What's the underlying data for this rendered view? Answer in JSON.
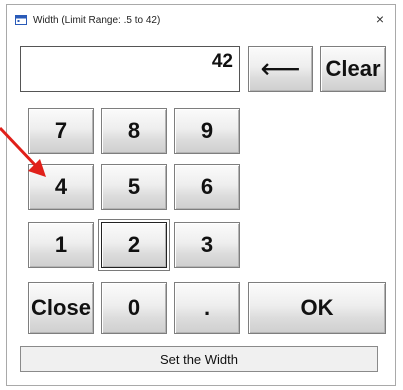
{
  "window": {
    "title_icon": "calculator-icon",
    "title": "Width   (Limit Range: .5 to 42)",
    "close_glyph": "×"
  },
  "display": {
    "value": "42"
  },
  "buttons": {
    "backspace_icon": "left-arrow-icon",
    "backspace_glyph": "⟵",
    "clear": "Clear",
    "seven": "7",
    "eight": "8",
    "nine": "9",
    "four": "4",
    "five": "5",
    "six": "6",
    "one": "1",
    "two": "2",
    "three": "3",
    "close": "Close",
    "zero": "0",
    "decimal": ".",
    "ok": "OK"
  },
  "status": {
    "text": "Set the Width"
  },
  "annotation": {
    "pointer_icon": "red-arrow-icon",
    "pointer_color": "#e0201a"
  },
  "colors": {
    "button_face": "#e6e6e6",
    "border": "#7e7e7e"
  }
}
